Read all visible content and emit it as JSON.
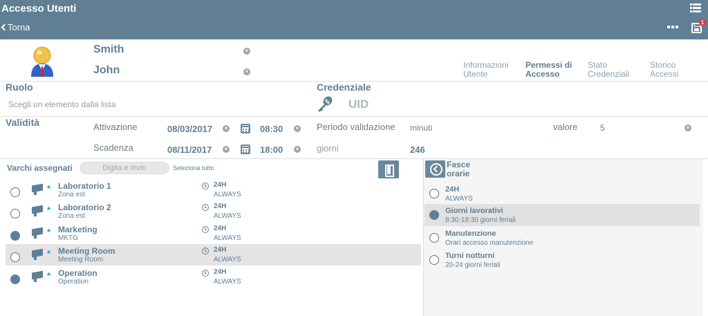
{
  "app": {
    "title": "Accesso Utenti",
    "back_label": "Torna",
    "save_badge": "1"
  },
  "user": {
    "last_name": "Smith",
    "first_name": "John"
  },
  "tabs": [
    {
      "label": "Informazioni Utente"
    },
    {
      "label": "Permessi di Accesso"
    },
    {
      "label": "Stato Credenziali"
    },
    {
      "label": "Storico Accessi"
    }
  ],
  "role": {
    "label": "Ruolo",
    "placeholder": "Scegli un elemento dalla lista"
  },
  "credential": {
    "label": "Credenziale",
    "value": "UID"
  },
  "validity": {
    "label": "Validità",
    "activation_label": "Attivazione",
    "activation_date": "08/03/2017",
    "activation_time": "08:30",
    "expiry_label": "Scadenza",
    "expiry_date": "08/11/2017",
    "expiry_time": "18:00",
    "period_label": "Periodo validazione",
    "period_unit": "minuti",
    "value_label": "valore",
    "value": "5",
    "days_label": "giorni",
    "days_value": "246"
  },
  "gates": {
    "label": "Varchi assegnati",
    "search_placeholder": "Digita e Invio",
    "select_all": "Seleziona tutto",
    "star": "*",
    "items": [
      {
        "name": "Laboratorio 1",
        "sub": "Zona est",
        "hours": "24H",
        "mode": "ALWAYS"
      },
      {
        "name": "Laboratorio 2",
        "sub": "Zona est",
        "hours": "24H",
        "mode": "ALWAYS"
      },
      {
        "name": "Marketing",
        "sub": "MKTG",
        "hours": "24H",
        "mode": "ALWAYS"
      },
      {
        "name": "Meeting Room",
        "sub": "Meeting Room",
        "hours": "24H",
        "mode": "ALWAYS"
      },
      {
        "name": "Operation",
        "sub": "Operation",
        "hours": "24H",
        "mode": "ALWAYS"
      }
    ]
  },
  "timebands": {
    "title_line1": "Fasce",
    "title_line2": "orarie",
    "items": [
      {
        "name": "24H",
        "sub": "ALWAYS"
      },
      {
        "name": "Giorni lavorativi",
        "sub": "8:30-18:30 giorni feriali"
      },
      {
        "name": "Manutenzione",
        "sub": "Orari accesso manutenzione"
      },
      {
        "name": "Turni notturni",
        "sub": "20-24 giorni feriali"
      }
    ]
  },
  "icons": {
    "clear": "×",
    "menu": "list-icon",
    "more": "more-dots-icon",
    "save": "save-icon",
    "calendar": "calendar-icon",
    "door": "door-icon",
    "back": "back-arrow-circle-icon",
    "gate": "gate-icon",
    "clock": "clock-icon",
    "key": "key-icon",
    "avatar": "user-avatar-icon"
  }
}
